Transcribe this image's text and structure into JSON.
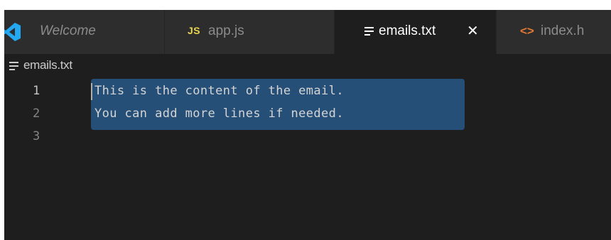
{
  "tabs": [
    {
      "label": "Welcome",
      "icon": "vscode-logo-icon",
      "active": false
    },
    {
      "label": "app.js",
      "icon": "js-file-icon",
      "icon_text": "JS",
      "active": false
    },
    {
      "label": "emails.txt",
      "icon": "text-file-icon",
      "active": true,
      "close": "✕"
    },
    {
      "label": "index.h",
      "icon": "html-file-icon",
      "icon_text": "<>",
      "active": false
    }
  ],
  "breadcrumb": {
    "icon": "text-file-icon",
    "label": "emails.txt"
  },
  "editor": {
    "lines": [
      {
        "number": "1",
        "text": "This is the content of the email."
      },
      {
        "number": "2",
        "text": "You can add more lines if needed."
      },
      {
        "number": "3",
        "text": ""
      }
    ]
  },
  "colors": {
    "editor_bg": "#1e1e1e",
    "tabbar_bg": "#252526",
    "inactive_tab_bg": "#2d2d2d",
    "selection": "#264f78",
    "vscode_blue": "#23a9f2",
    "js_yellow": "#e8d44d",
    "html_orange": "#e37933"
  }
}
